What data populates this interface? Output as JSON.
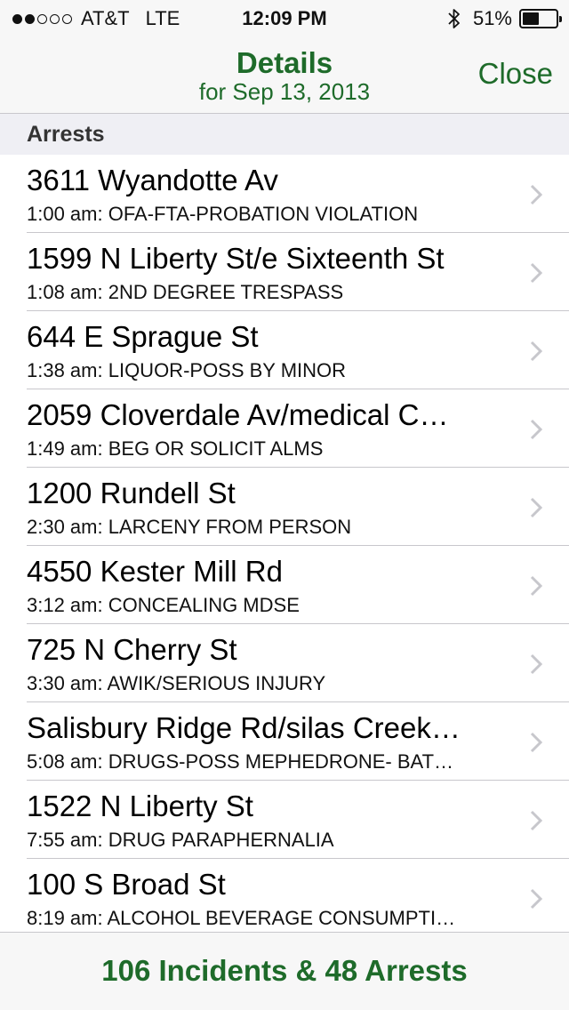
{
  "status_bar": {
    "signal_bars_filled": 2,
    "signal_bars_total": 5,
    "carrier": "AT&T",
    "network": "LTE",
    "time": "12:09 PM",
    "bluetooth_icon": "bluetooth-icon",
    "battery_text": "51%",
    "battery_level": 0.51
  },
  "nav": {
    "title": "Details",
    "subtitle": "for Sep 13, 2013",
    "close_label": "Close"
  },
  "section": {
    "header": "Arrests"
  },
  "rows": [
    {
      "title": "3611 Wyandotte Av",
      "subtitle": "1:00 am: OFA-FTA-PROBATION VIOLATION"
    },
    {
      "title": "1599 N Liberty St/e Sixteenth St",
      "subtitle": "1:08 am: 2ND DEGREE TRESPASS"
    },
    {
      "title": "644 E Sprague St",
      "subtitle": "1:38 am: LIQUOR-POSS BY MINOR"
    },
    {
      "title": "2059 Cloverdale Av/medical C…",
      "subtitle": "1:49 am: BEG OR SOLICIT ALMS"
    },
    {
      "title": "1200 Rundell St",
      "subtitle": "2:30 am: LARCENY FROM PERSON"
    },
    {
      "title": "4550 Kester Mill Rd",
      "subtitle": "3:12 am: CONCEALING MDSE"
    },
    {
      "title": "725 N Cherry St",
      "subtitle": "3:30 am: AWIK/SERIOUS INJURY"
    },
    {
      "title": "Salisbury Ridge Rd/silas Creek…",
      "subtitle": "5:08 am: DRUGS-POSS MEPHEDRONE- BAT…"
    },
    {
      "title": "1522 N Liberty St",
      "subtitle": "7:55 am: DRUG PARAPHERNALIA"
    },
    {
      "title": "100 S Broad St",
      "subtitle": "8:19 am: ALCOHOL BEVERAGE CONSUMPTI…"
    }
  ],
  "toolbar": {
    "summary": "106 Incidents & 48 Arrests"
  },
  "colors": {
    "accent": "#1e6b2a",
    "bar_background": "#f7f7f7",
    "section_background": "#efeff4",
    "separator": "#c8c7cc"
  }
}
